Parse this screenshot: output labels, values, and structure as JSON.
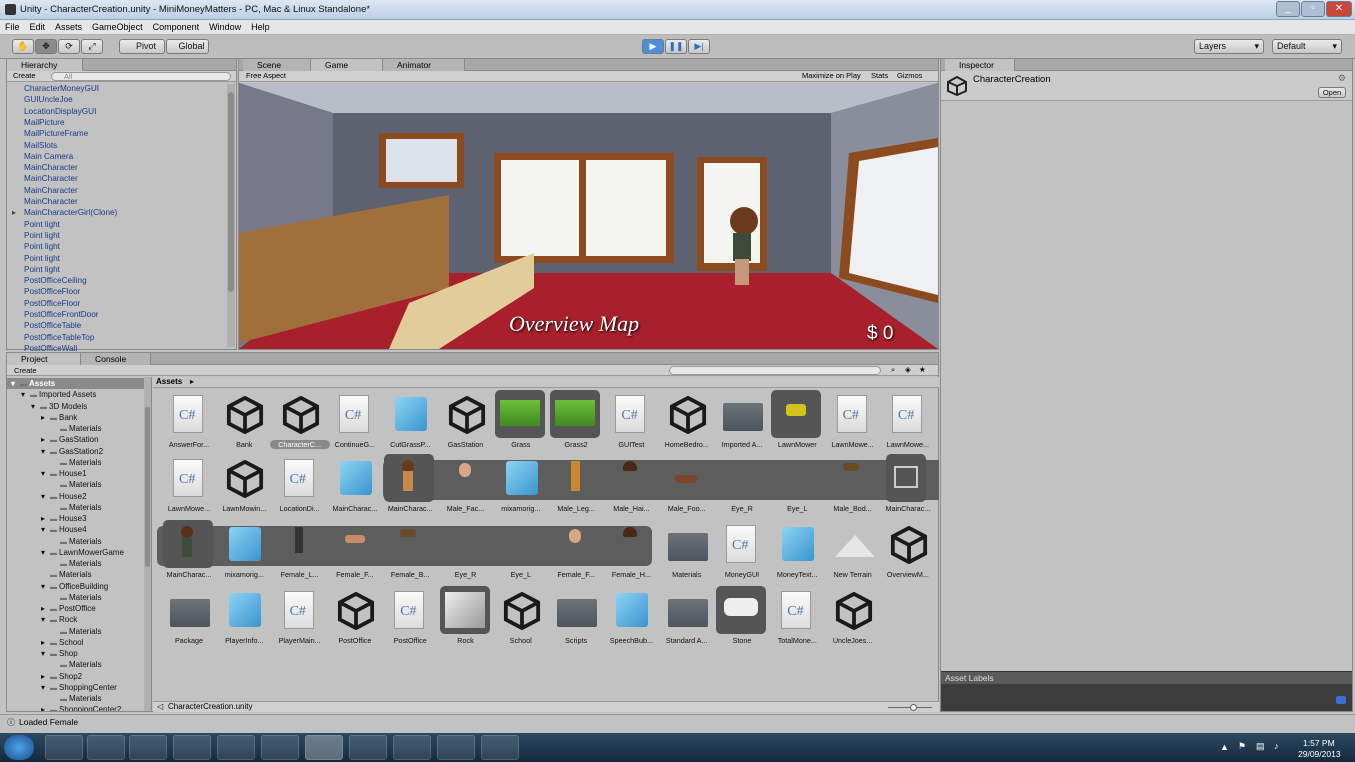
{
  "window": {
    "title": "Unity - CharacterCreation.unity - MiniMoneyMatters - PC, Mac & Linux Standalone*"
  },
  "menu": [
    "File",
    "Edit",
    "Assets",
    "GameObject",
    "Component",
    "Window",
    "Help"
  ],
  "toolbar": {
    "pivot": "Pivot",
    "global": "Global",
    "layers": "Layers",
    "layout": "Default"
  },
  "hierarchy": {
    "tab": "Hierarchy",
    "create": "Create",
    "search": "All",
    "items": [
      "CharacterMoneyGUI",
      "GUIUncleJoe",
      "LocationDisplayGUI",
      "MailPicture",
      "MailPictureFrame",
      "MailSlots",
      "Main Camera",
      "MainCharacter",
      "MainCharacter",
      "MainCharacter",
      "MainCharacter",
      "MainCharacterGirl(Clone)",
      "Point light",
      "Point light",
      "Point light",
      "Point light",
      "Point light",
      "PostOfficeCeiling",
      "PostOfficeFloor",
      "PostOfficeFloor",
      "PostOfficeFrontDoor",
      "PostOfficeTable",
      "PostOfficeTableTop",
      "PostOfficeWall"
    ]
  },
  "view": {
    "tabs": [
      "Scene",
      "Game",
      "Animator"
    ],
    "aspect": "Free Aspect",
    "options": [
      "Maximize on Play",
      "Stats",
      "Gizmos"
    ],
    "overlay_title": "Overview Map",
    "money": "$ 0"
  },
  "inspector": {
    "tab": "Inspector",
    "object": "CharacterCreation",
    "open": "Open",
    "asset_labels": "Asset Labels"
  },
  "project": {
    "tabs": [
      "Project",
      "Console"
    ],
    "create": "Create",
    "breadcrumb": "Assets",
    "tree": [
      {
        "label": "Assets",
        "indent": 0
      },
      {
        "label": "Imported Assets",
        "indent": 1
      },
      {
        "label": "3D Models",
        "indent": 2
      },
      {
        "label": "Bank",
        "indent": 3
      },
      {
        "label": "Materials",
        "indent": 4
      },
      {
        "label": "GasStation",
        "indent": 3
      },
      {
        "label": "GasStation2",
        "indent": 3
      },
      {
        "label": "Materials",
        "indent": 4
      },
      {
        "label": "House1",
        "indent": 3
      },
      {
        "label": "Materials",
        "indent": 4
      },
      {
        "label": "House2",
        "indent": 3
      },
      {
        "label": "Materials",
        "indent": 4
      },
      {
        "label": "House3",
        "indent": 3
      },
      {
        "label": "House4",
        "indent": 3
      },
      {
        "label": "Materials",
        "indent": 4
      },
      {
        "label": "LawnMowerGame",
        "indent": 3
      },
      {
        "label": "Materials",
        "indent": 4
      },
      {
        "label": "Materials",
        "indent": 3
      },
      {
        "label": "OfficeBuilding",
        "indent": 3
      },
      {
        "label": "Materials",
        "indent": 4
      },
      {
        "label": "PostOffice",
        "indent": 3
      },
      {
        "label": "Rock",
        "indent": 3
      },
      {
        "label": "Materials",
        "indent": 4
      },
      {
        "label": "School",
        "indent": 3
      },
      {
        "label": "Shop",
        "indent": 3
      },
      {
        "label": "Materials",
        "indent": 4
      },
      {
        "label": "Shop2",
        "indent": 3
      },
      {
        "label": "ShoppingCenter",
        "indent": 3
      },
      {
        "label": "Materials",
        "indent": 4
      },
      {
        "label": "ShoppingCenter2",
        "indent": 3
      }
    ],
    "rows": [
      [
        {
          "l": "AnswerFor...",
          "t": "cs"
        },
        {
          "l": "Bank",
          "t": "u"
        },
        {
          "l": "CharacterC...",
          "t": "u"
        },
        {
          "l": "ContinueG...",
          "t": "cs"
        },
        {
          "l": "CutGrassP...",
          "t": "cube"
        },
        {
          "l": "GasStation",
          "t": "u"
        },
        {
          "l": "Grass",
          "t": "grass"
        },
        {
          "l": "Grass2",
          "t": "grass"
        },
        {
          "l": "GUITest",
          "t": "cs"
        },
        {
          "l": "HomeBedro...",
          "t": "u"
        },
        {
          "l": "Imported A...",
          "t": "folder"
        },
        {
          "l": "LawnMower",
          "t": "mower"
        },
        {
          "l": "LawnMowe...",
          "t": "cs"
        },
        {
          "l": "LawnMowe...",
          "t": "cs"
        }
      ],
      [
        {
          "l": "LawnMowe...",
          "t": "cs"
        },
        {
          "l": "LawnMowin...",
          "t": "u"
        },
        {
          "l": "LocationDi...",
          "t": "cs"
        },
        {
          "l": "MainCharac...",
          "t": "cube"
        },
        {
          "l": "MainCharac...",
          "t": "char"
        },
        {
          "l": "Male_Fac...",
          "t": "face"
        },
        {
          "l": "mixamorig...",
          "t": "cube"
        },
        {
          "l": "Male_Leg...",
          "t": "leg"
        },
        {
          "l": "Male_Hai...",
          "t": "hair"
        },
        {
          "l": "Male_Foo...",
          "t": "shoe"
        },
        {
          "l": "Eye_R",
          "t": "none"
        },
        {
          "l": "Eye_L",
          "t": "none"
        },
        {
          "l": "Male_Bod...",
          "t": "body"
        },
        {
          "l": "MainCharac...",
          "t": "anim"
        }
      ],
      [
        {
          "l": "MainCharac...",
          "t": "char2"
        },
        {
          "l": "mixamorig...",
          "t": "cube"
        },
        {
          "l": "Female_L...",
          "t": "leg2"
        },
        {
          "l": "Female_F...",
          "t": "shoe2"
        },
        {
          "l": "Female_B...",
          "t": "body"
        },
        {
          "l": "Eye_R",
          "t": "none"
        },
        {
          "l": "Eye_L",
          "t": "none"
        },
        {
          "l": "Female_F...",
          "t": "face"
        },
        {
          "l": "Female_H...",
          "t": "hair"
        },
        {
          "l": "Materials",
          "t": "folder"
        },
        {
          "l": "MoneyGUI",
          "t": "cs"
        },
        {
          "l": "MoneyText...",
          "t": "cube"
        },
        {
          "l": "New Terrain",
          "t": "terrain"
        },
        {
          "l": "OverviewM...",
          "t": "u"
        }
      ],
      [
        {
          "l": "Package",
          "t": "folder"
        },
        {
          "l": "PlayerInfo...",
          "t": "cube"
        },
        {
          "l": "PlayerMain...",
          "t": "cs"
        },
        {
          "l": "PostOffice",
          "t": "u"
        },
        {
          "l": "PostOffice",
          "t": "cs"
        },
        {
          "l": "Rock",
          "t": "rock"
        },
        {
          "l": "School",
          "t": "u"
        },
        {
          "l": "Scripts",
          "t": "folder"
        },
        {
          "l": "SpeechBub...",
          "t": "cube"
        },
        {
          "l": "Standard A...",
          "t": "folder"
        },
        {
          "l": "Stone",
          "t": "stone"
        },
        {
          "l": "TotalMone...",
          "t": "cs"
        },
        {
          "l": "UncleJoes...",
          "t": "u"
        }
      ]
    ],
    "footer": "CharacterCreation.unity"
  },
  "status": "Loaded Female",
  "taskbar": {
    "time": "1:57 PM",
    "date": "29/09/2013"
  },
  "colors": {
    "selection": "#3d6fb5",
    "unity_dark": "#222222",
    "play_active": "#4a90d9"
  }
}
